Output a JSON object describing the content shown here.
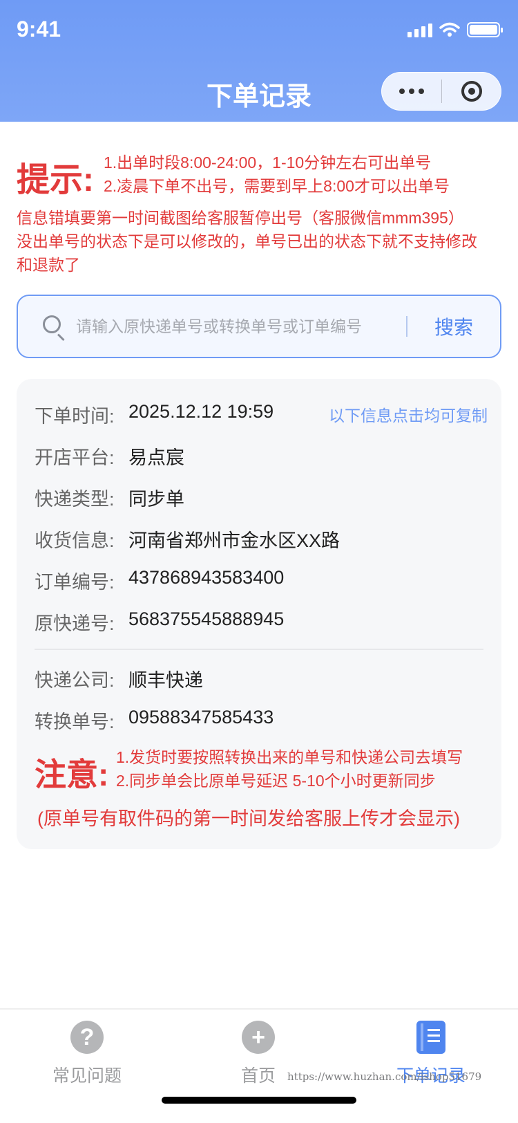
{
  "status_bar": {
    "time": "9:41"
  },
  "header": {
    "title": "下单记录"
  },
  "tip": {
    "label": "提示:",
    "lines": [
      "1.出单时段8:00-24:00，1-10分钟左右可出单号",
      "2.凌晨下单不出号，需要到早上8:00才可以出单号"
    ]
  },
  "notice": {
    "lines": [
      "信息错填要第一时间截图给客服暂停出号（客服微信mmm395）",
      "没出单号的状态下是可以修改的，单号已出的状态下就不支持修改",
      "和退款了"
    ]
  },
  "search": {
    "placeholder": "请输入原快递单号或转换单号或订单编号",
    "button": "搜索",
    "value": ""
  },
  "record": {
    "copy_hint": "以下信息点击均可复制",
    "fields": [
      {
        "label": "下单时间:",
        "value": "2025.12.12 19:59"
      },
      {
        "label": "开店平台:",
        "value": "易点宸"
      },
      {
        "label": "快递类型:",
        "value": "同步单"
      },
      {
        "label": "收货信息:",
        "value": "河南省郑州市金水区XX路"
      },
      {
        "label": "订单编号:",
        "value": "437868943583400"
      },
      {
        "label": "原快递号:",
        "value": "568375545888945"
      },
      {
        "label": "快递公司:",
        "value": "顺丰快递"
      },
      {
        "label": "转换单号:",
        "value": "09588347585433"
      }
    ],
    "warning": {
      "label": "注意:",
      "lines": [
        "1.发货时要按照转换出来的单号和快递公司去填写",
        "2.同步单会比原单号延迟 5-10个小时更新同步"
      ],
      "footer": "(原单号有取件码的第一时间发给客服上传才会显示)"
    }
  },
  "tabbar": {
    "items": [
      {
        "label": "常见问题",
        "icon": "question-icon"
      },
      {
        "label": "首页",
        "icon": "plus-icon"
      },
      {
        "label": "下单记录",
        "icon": "book-icon",
        "active": true
      }
    ]
  },
  "watermark": "https://www.huzhan.com/ishop51679",
  "colors": {
    "accent": "#4f85ef",
    "header": "#6f9bf5",
    "warning": "#e23b3b"
  }
}
